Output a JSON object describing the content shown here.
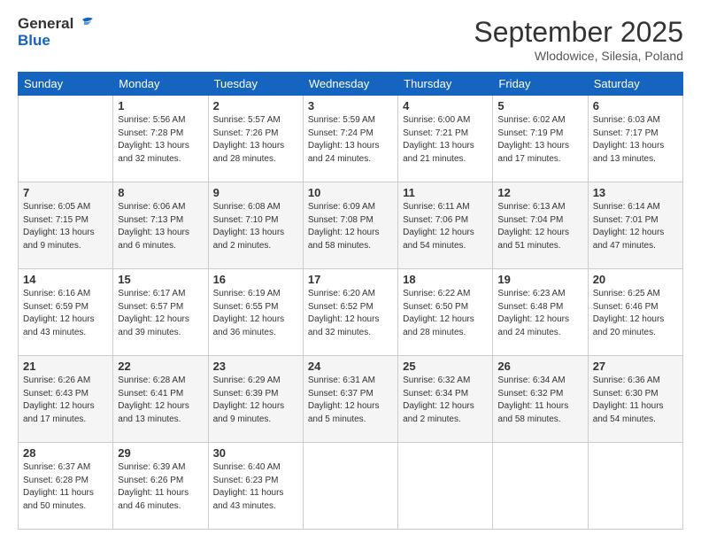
{
  "header": {
    "logo_line1": "General",
    "logo_line2": "Blue",
    "month": "September 2025",
    "location": "Wlodowice, Silesia, Poland"
  },
  "weekdays": [
    "Sunday",
    "Monday",
    "Tuesday",
    "Wednesday",
    "Thursday",
    "Friday",
    "Saturday"
  ],
  "weeks": [
    [
      {
        "day": "",
        "info": ""
      },
      {
        "day": "1",
        "info": "Sunrise: 5:56 AM\nSunset: 7:28 PM\nDaylight: 13 hours\nand 32 minutes."
      },
      {
        "day": "2",
        "info": "Sunrise: 5:57 AM\nSunset: 7:26 PM\nDaylight: 13 hours\nand 28 minutes."
      },
      {
        "day": "3",
        "info": "Sunrise: 5:59 AM\nSunset: 7:24 PM\nDaylight: 13 hours\nand 24 minutes."
      },
      {
        "day": "4",
        "info": "Sunrise: 6:00 AM\nSunset: 7:21 PM\nDaylight: 13 hours\nand 21 minutes."
      },
      {
        "day": "5",
        "info": "Sunrise: 6:02 AM\nSunset: 7:19 PM\nDaylight: 13 hours\nand 17 minutes."
      },
      {
        "day": "6",
        "info": "Sunrise: 6:03 AM\nSunset: 7:17 PM\nDaylight: 13 hours\nand 13 minutes."
      }
    ],
    [
      {
        "day": "7",
        "info": "Sunrise: 6:05 AM\nSunset: 7:15 PM\nDaylight: 13 hours\nand 9 minutes."
      },
      {
        "day": "8",
        "info": "Sunrise: 6:06 AM\nSunset: 7:13 PM\nDaylight: 13 hours\nand 6 minutes."
      },
      {
        "day": "9",
        "info": "Sunrise: 6:08 AM\nSunset: 7:10 PM\nDaylight: 13 hours\nand 2 minutes."
      },
      {
        "day": "10",
        "info": "Sunrise: 6:09 AM\nSunset: 7:08 PM\nDaylight: 12 hours\nand 58 minutes."
      },
      {
        "day": "11",
        "info": "Sunrise: 6:11 AM\nSunset: 7:06 PM\nDaylight: 12 hours\nand 54 minutes."
      },
      {
        "day": "12",
        "info": "Sunrise: 6:13 AM\nSunset: 7:04 PM\nDaylight: 12 hours\nand 51 minutes."
      },
      {
        "day": "13",
        "info": "Sunrise: 6:14 AM\nSunset: 7:01 PM\nDaylight: 12 hours\nand 47 minutes."
      }
    ],
    [
      {
        "day": "14",
        "info": "Sunrise: 6:16 AM\nSunset: 6:59 PM\nDaylight: 12 hours\nand 43 minutes."
      },
      {
        "day": "15",
        "info": "Sunrise: 6:17 AM\nSunset: 6:57 PM\nDaylight: 12 hours\nand 39 minutes."
      },
      {
        "day": "16",
        "info": "Sunrise: 6:19 AM\nSunset: 6:55 PM\nDaylight: 12 hours\nand 36 minutes."
      },
      {
        "day": "17",
        "info": "Sunrise: 6:20 AM\nSunset: 6:52 PM\nDaylight: 12 hours\nand 32 minutes."
      },
      {
        "day": "18",
        "info": "Sunrise: 6:22 AM\nSunset: 6:50 PM\nDaylight: 12 hours\nand 28 minutes."
      },
      {
        "day": "19",
        "info": "Sunrise: 6:23 AM\nSunset: 6:48 PM\nDaylight: 12 hours\nand 24 minutes."
      },
      {
        "day": "20",
        "info": "Sunrise: 6:25 AM\nSunset: 6:46 PM\nDaylight: 12 hours\nand 20 minutes."
      }
    ],
    [
      {
        "day": "21",
        "info": "Sunrise: 6:26 AM\nSunset: 6:43 PM\nDaylight: 12 hours\nand 17 minutes."
      },
      {
        "day": "22",
        "info": "Sunrise: 6:28 AM\nSunset: 6:41 PM\nDaylight: 12 hours\nand 13 minutes."
      },
      {
        "day": "23",
        "info": "Sunrise: 6:29 AM\nSunset: 6:39 PM\nDaylight: 12 hours\nand 9 minutes."
      },
      {
        "day": "24",
        "info": "Sunrise: 6:31 AM\nSunset: 6:37 PM\nDaylight: 12 hours\nand 5 minutes."
      },
      {
        "day": "25",
        "info": "Sunrise: 6:32 AM\nSunset: 6:34 PM\nDaylight: 12 hours\nand 2 minutes."
      },
      {
        "day": "26",
        "info": "Sunrise: 6:34 AM\nSunset: 6:32 PM\nDaylight: 11 hours\nand 58 minutes."
      },
      {
        "day": "27",
        "info": "Sunrise: 6:36 AM\nSunset: 6:30 PM\nDaylight: 11 hours\nand 54 minutes."
      }
    ],
    [
      {
        "day": "28",
        "info": "Sunrise: 6:37 AM\nSunset: 6:28 PM\nDaylight: 11 hours\nand 50 minutes."
      },
      {
        "day": "29",
        "info": "Sunrise: 6:39 AM\nSunset: 6:26 PM\nDaylight: 11 hours\nand 46 minutes."
      },
      {
        "day": "30",
        "info": "Sunrise: 6:40 AM\nSunset: 6:23 PM\nDaylight: 11 hours\nand 43 minutes."
      },
      {
        "day": "",
        "info": ""
      },
      {
        "day": "",
        "info": ""
      },
      {
        "day": "",
        "info": ""
      },
      {
        "day": "",
        "info": ""
      }
    ]
  ]
}
